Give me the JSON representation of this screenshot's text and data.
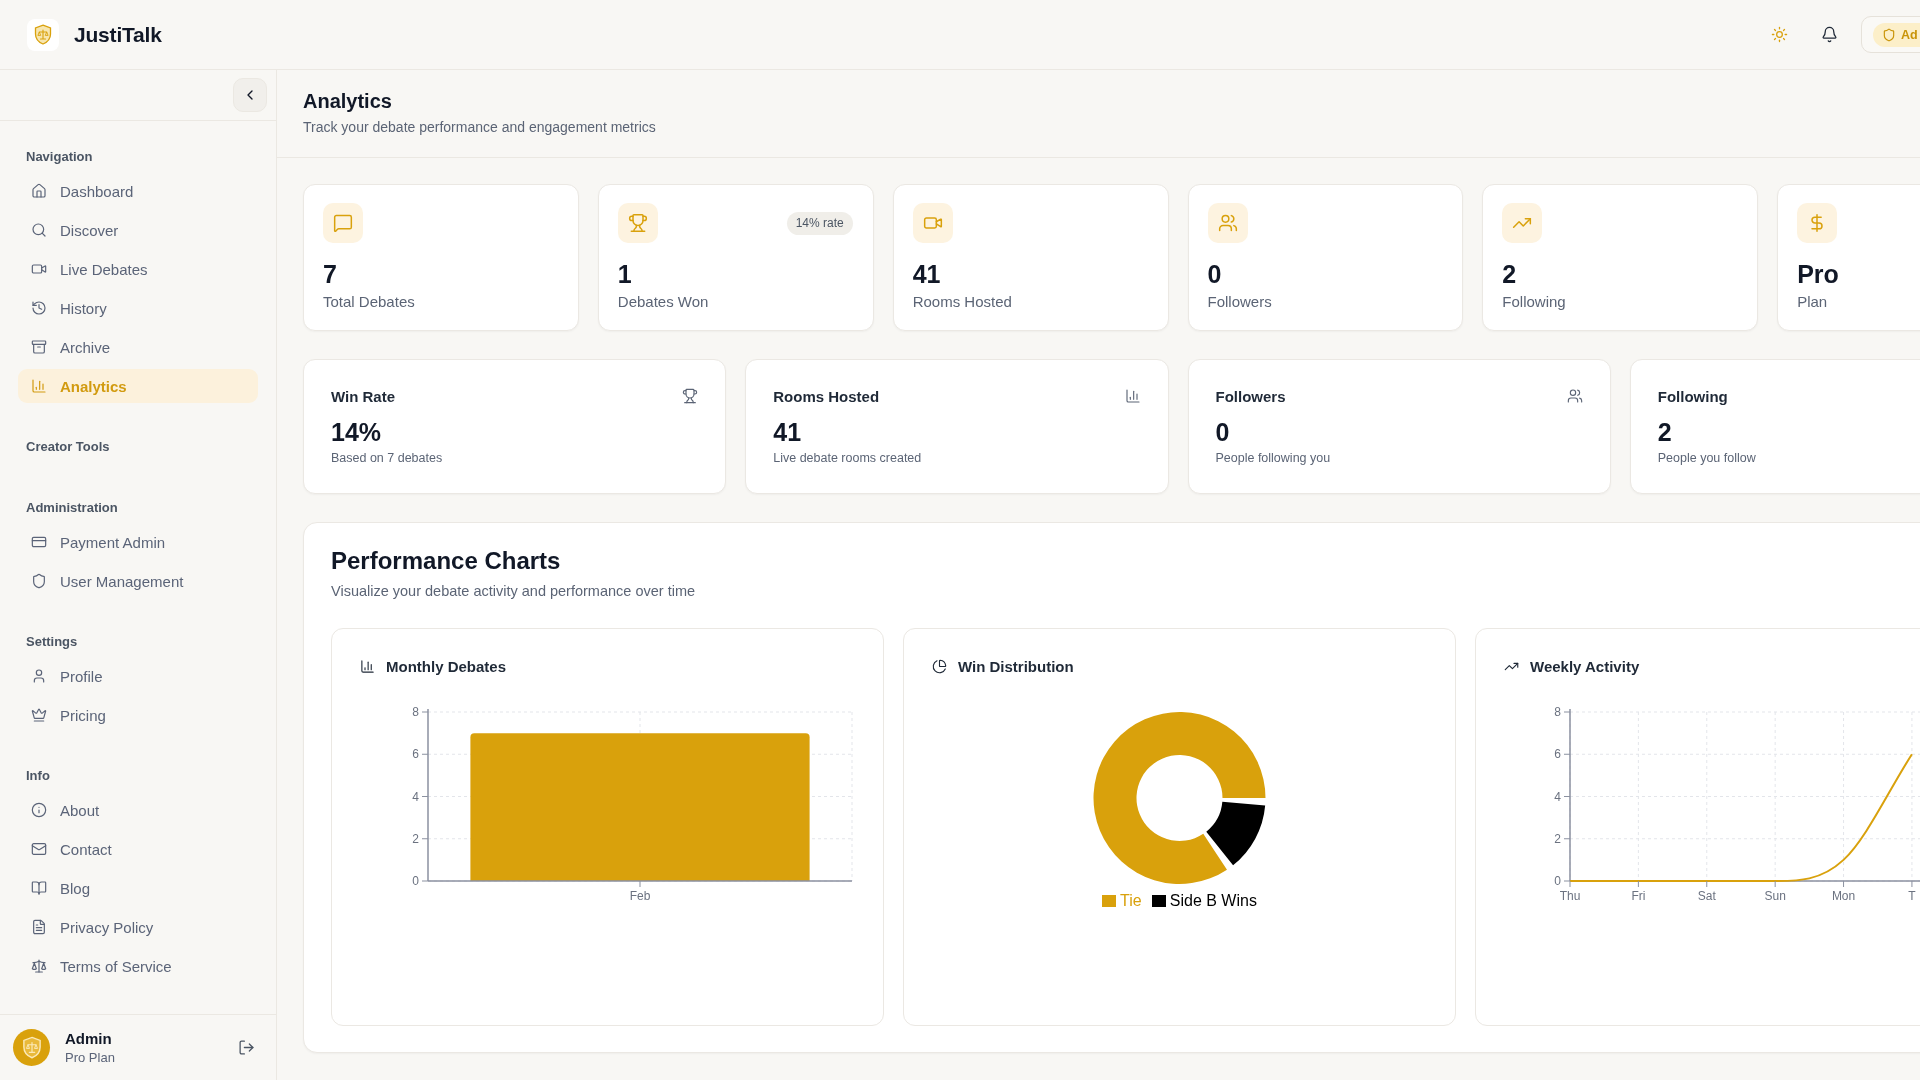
{
  "header": {
    "app_name": "JustiTalk",
    "role_badge": "Ad"
  },
  "sidebar": {
    "sections": [
      {
        "label": "Navigation",
        "items": [
          {
            "label": "Dashboard",
            "selected": false
          },
          {
            "label": "Discover",
            "selected": false
          },
          {
            "label": "Live Debates",
            "selected": false
          },
          {
            "label": "History",
            "selected": false
          },
          {
            "label": "Archive",
            "selected": false
          },
          {
            "label": "Analytics",
            "selected": true
          }
        ]
      },
      {
        "label": "Creator Tools"
      },
      {
        "label": "Administration",
        "items": [
          {
            "label": "Payment Admin",
            "selected": false
          },
          {
            "label": "User Management",
            "selected": false
          }
        ]
      },
      {
        "label": "Settings",
        "items": [
          {
            "label": "Profile",
            "selected": false
          },
          {
            "label": "Pricing",
            "selected": false
          }
        ]
      },
      {
        "label": "Info",
        "items": [
          {
            "label": "About",
            "selected": false
          },
          {
            "label": "Contact",
            "selected": false
          },
          {
            "label": "Blog",
            "selected": false
          },
          {
            "label": "Privacy Policy",
            "selected": false
          },
          {
            "label": "Terms of Service",
            "selected": false
          }
        ]
      }
    ],
    "user": {
      "name": "Admin",
      "plan": "Pro Plan"
    }
  },
  "page": {
    "title": "Analytics",
    "subtitle": "Track your debate performance and engagement metrics"
  },
  "stat_cards": [
    {
      "value": "7",
      "label": "Total Debates"
    },
    {
      "value": "1",
      "label": "Debates Won",
      "badge": "14% rate"
    },
    {
      "value": "41",
      "label": "Rooms Hosted"
    },
    {
      "value": "0",
      "label": "Followers"
    },
    {
      "value": "2",
      "label": "Following"
    },
    {
      "value": "Pro",
      "label": "Plan"
    }
  ],
  "metric_cards": [
    {
      "title": "Win Rate",
      "value": "14%",
      "caption": "Based on 7 debates"
    },
    {
      "title": "Rooms Hosted",
      "value": "41",
      "caption": "Live debate rooms created"
    },
    {
      "title": "Followers",
      "value": "0",
      "caption": "People following you"
    },
    {
      "title": "Following",
      "value": "2",
      "caption": "People you follow"
    }
  ],
  "performance": {
    "title": "Performance Charts",
    "subtitle": "Visualize your debate activity and performance over time",
    "charts": [
      {
        "title": "Monthly Debates",
        "chart_data": {
          "type": "bar",
          "categories": [
            "Feb"
          ],
          "values": [
            7
          ],
          "ylim": [
            0,
            8
          ],
          "yticks": [
            0,
            2,
            4,
            6,
            8
          ],
          "grid": true
        }
      },
      {
        "title": "Win Distribution",
        "chart_data": {
          "type": "donut",
          "categories": [
            "Tie",
            "Side B Wins"
          ],
          "values": [
            85.7,
            14.3
          ],
          "colors": [
            "#d9a10c",
            "#000000"
          ]
        }
      },
      {
        "title": "Weekly Activity",
        "chart_data": {
          "type": "line",
          "categories": [
            "Thu",
            "Fri",
            "Sat",
            "Sun",
            "Mon",
            "T"
          ],
          "values": [
            0,
            0,
            0,
            0,
            1,
            6
          ],
          "ylim": [
            0,
            8
          ],
          "yticks": [
            0,
            2,
            4,
            6,
            8
          ],
          "grid": true
        }
      }
    ]
  }
}
